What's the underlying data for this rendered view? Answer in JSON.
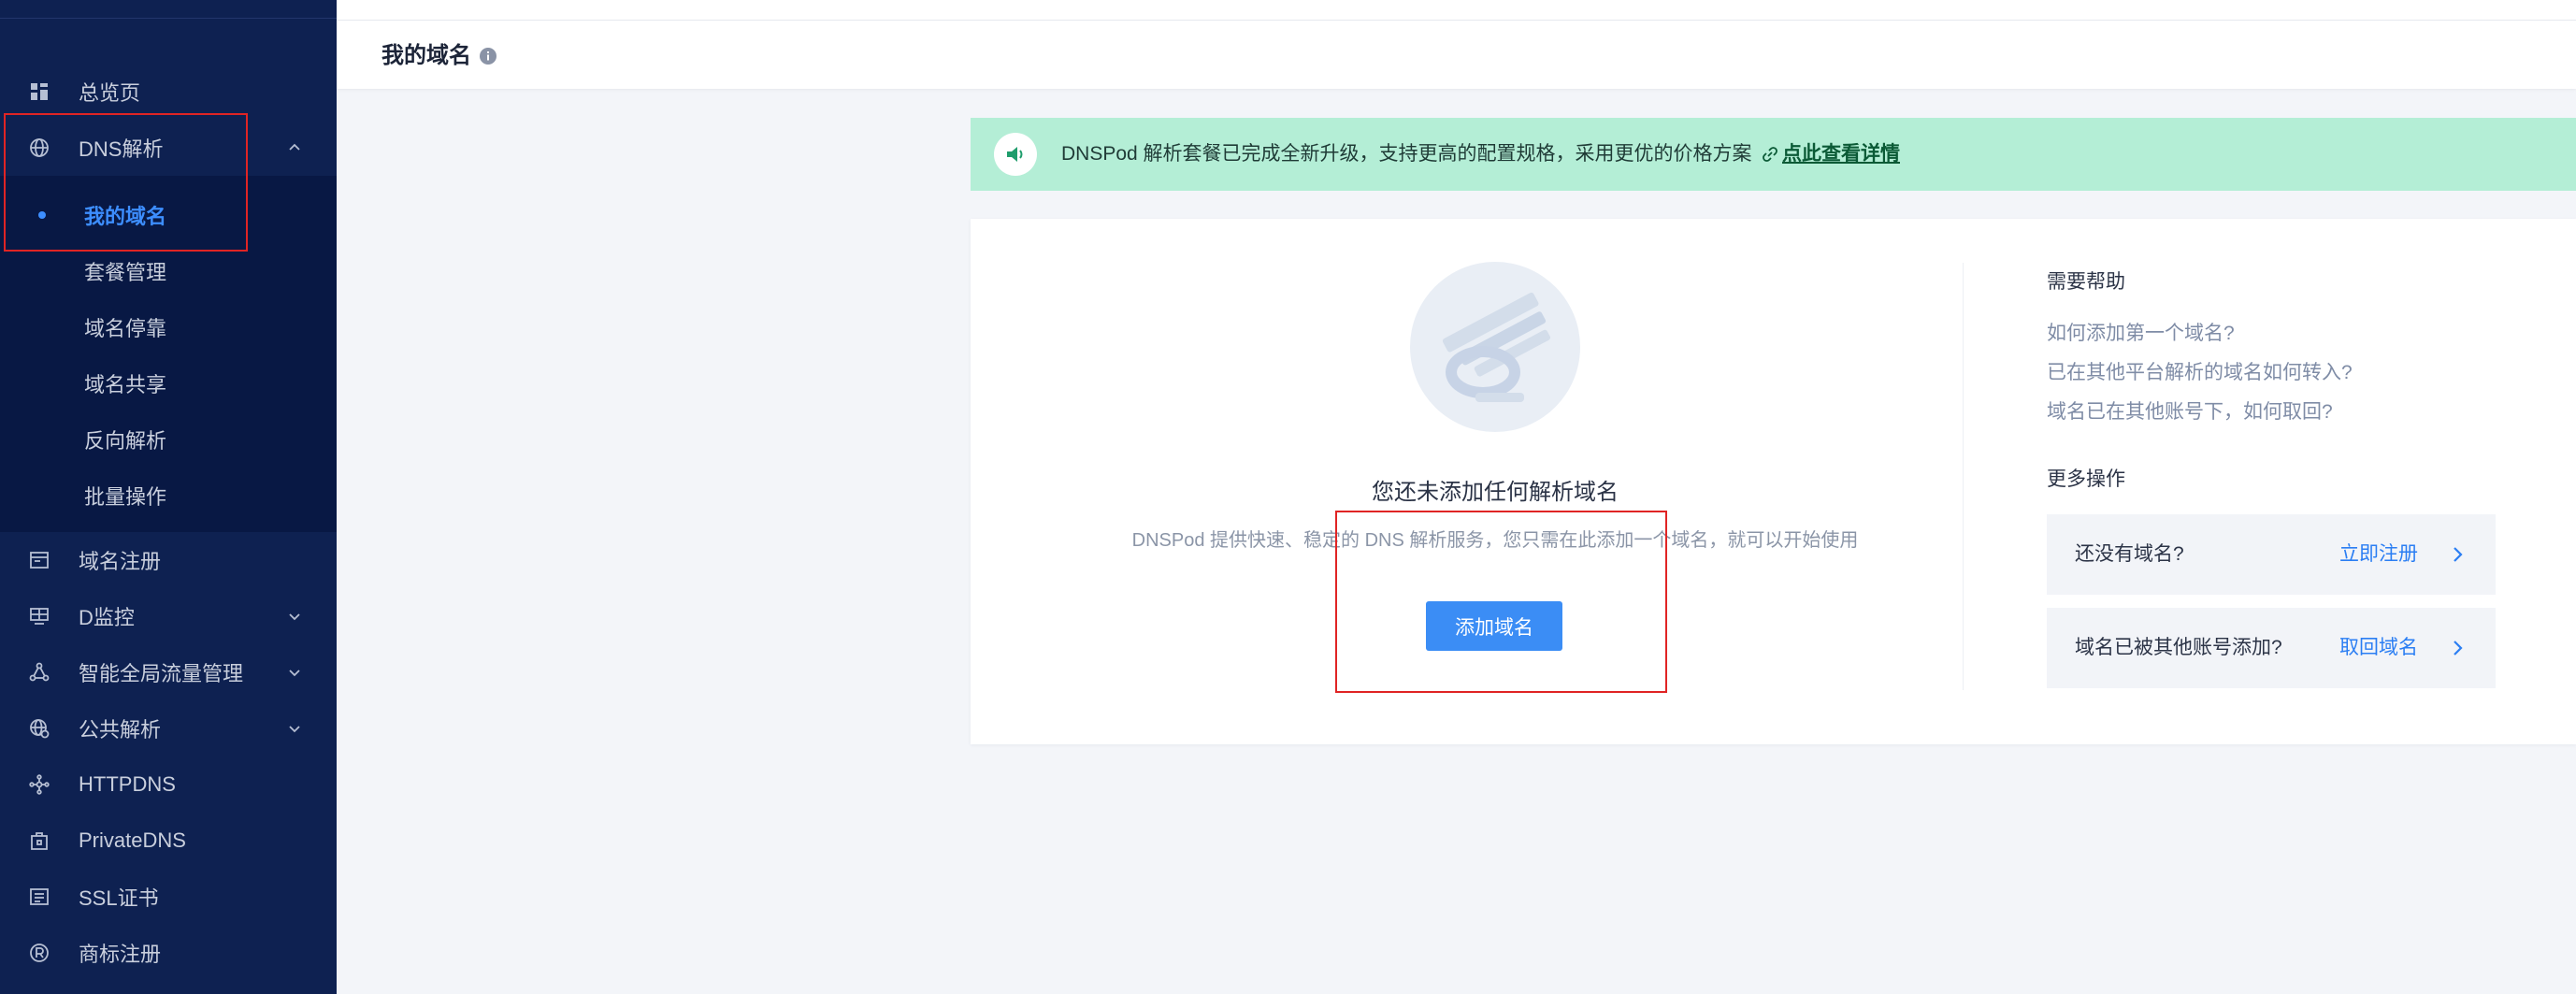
{
  "sidebar": {
    "overview": {
      "label": "总览页",
      "icon": "dashboard-icon"
    },
    "dns": {
      "label": "DNS解析",
      "icon": "globe-icon",
      "expanded": true,
      "children": [
        {
          "label": "我的域名",
          "active": true
        },
        {
          "label": "套餐管理"
        },
        {
          "label": "域名停靠"
        },
        {
          "label": "域名共享"
        },
        {
          "label": "反向解析"
        },
        {
          "label": "批量操作"
        }
      ]
    },
    "items": [
      {
        "label": "域名注册",
        "icon": "domain-register-icon",
        "expandable": false
      },
      {
        "label": "D监控",
        "icon": "monitor-icon",
        "expandable": true
      },
      {
        "label": "智能全局流量管理",
        "icon": "traffic-management-icon",
        "expandable": true
      },
      {
        "label": "公共解析",
        "icon": "public-dns-icon",
        "expandable": true
      },
      {
        "label": "HTTPDNS",
        "icon": "httpdns-icon",
        "expandable": false
      },
      {
        "label": "PrivateDNS",
        "icon": "private-dns-icon",
        "expandable": false
      },
      {
        "label": "SSL证书",
        "icon": "ssl-certificate-icon",
        "expandable": false
      },
      {
        "label": "商标注册",
        "icon": "trademark-icon",
        "expandable": false
      }
    ]
  },
  "header": {
    "title": "我的域名",
    "icon": "info-icon"
  },
  "banner": {
    "icon": "speaker-icon",
    "text": "DNSPod 解析套餐已完成全新升级，支持更高的配置规格，采用更优的价格方案",
    "link_icon": "link-icon",
    "link": "点此查看详情"
  },
  "empty_state": {
    "title": "您还未添加任何解析域名",
    "description": "DNSPod 提供快速、稳定的 DNS 解析服务，您只需在此添加一个域名，就可以开始使用",
    "button": "添加域名"
  },
  "help": {
    "title": "需要帮助",
    "links": [
      "如何添加第一个域名?",
      "已在其他平台解析的域名如何转入?",
      "域名已在其他账号下，如何取回?"
    ]
  },
  "more_actions": {
    "title": "更多操作",
    "actions": [
      {
        "label": "还没有域名?",
        "link": "立即注册"
      },
      {
        "label": "域名已被其他账号添加?",
        "link": "取回域名"
      }
    ]
  },
  "colors": {
    "sidebar_bg": "#0e2151",
    "submenu_bg": "#081844",
    "active": "#3d8eff",
    "banner_bg": "#b4eed6",
    "primary": "#3b8df5",
    "highlight": "#e02424"
  }
}
